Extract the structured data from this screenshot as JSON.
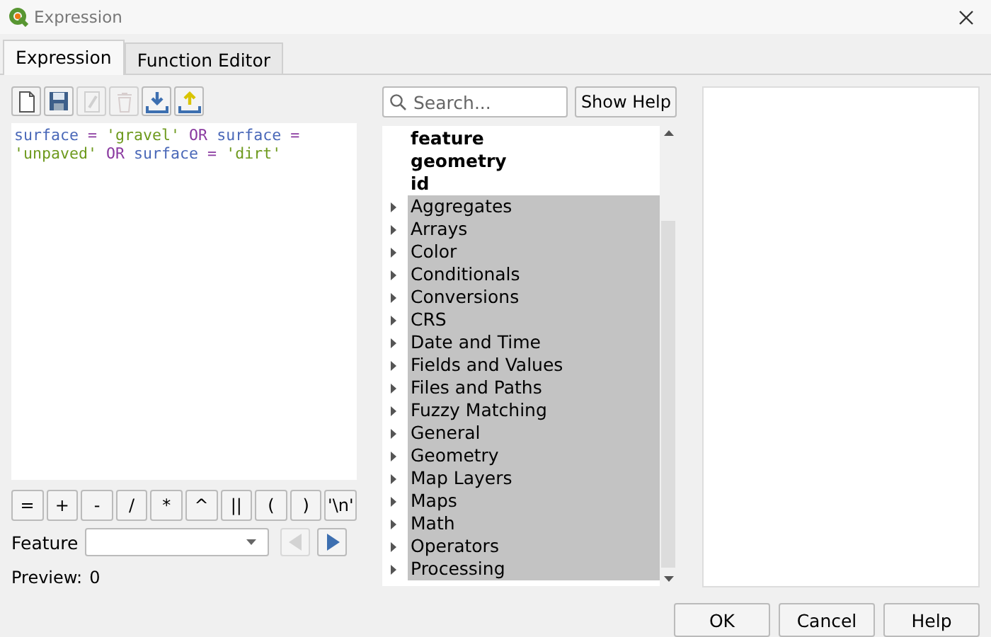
{
  "window": {
    "title": "Expression"
  },
  "tabs": [
    {
      "label": "Expression",
      "selected": true
    },
    {
      "label": "Function Editor",
      "selected": false
    }
  ],
  "toolbar": [
    {
      "kind": "new",
      "disabled": false
    },
    {
      "kind": "save",
      "disabled": false
    },
    {
      "kind": "edit",
      "disabled": true
    },
    {
      "kind": "delete",
      "disabled": true
    },
    {
      "kind": "import",
      "disabled": false
    },
    {
      "kind": "export",
      "disabled": false
    }
  ],
  "expression": [
    {
      "kind": "field",
      "text": "surface"
    },
    {
      "kind": "op",
      "text": " = "
    },
    {
      "kind": "string",
      "text": "'gravel'"
    },
    {
      "kind": "op",
      "text": " OR "
    },
    {
      "kind": "field",
      "text": "surface"
    },
    {
      "kind": "op",
      "text": " = "
    },
    {
      "kind": "string",
      "text": "'unpaved'"
    },
    {
      "kind": "op",
      "text": " OR "
    },
    {
      "kind": "field",
      "text": "surface"
    },
    {
      "kind": "op",
      "text": " = "
    },
    {
      "kind": "string",
      "text": "'dirt'"
    }
  ],
  "operators": [
    "=",
    "+",
    "-",
    "/",
    "*",
    "^",
    "||",
    "(",
    ")",
    "'\\n'"
  ],
  "feature": {
    "label": "Feature",
    "prev_disabled": true,
    "next_disabled": false
  },
  "preview": {
    "label": "Preview:",
    "value": "0"
  },
  "search": {
    "placeholder": "Search..."
  },
  "show_help": "Show Help",
  "tree": [
    {
      "kind": "field",
      "label": "feature"
    },
    {
      "kind": "field",
      "label": "geometry"
    },
    {
      "kind": "field",
      "label": "id"
    },
    {
      "kind": "group",
      "label": "Aggregates",
      "expanded": false
    },
    {
      "kind": "group",
      "label": "Arrays",
      "expanded": false
    },
    {
      "kind": "group",
      "label": "Color",
      "expanded": false
    },
    {
      "kind": "group",
      "label": "Conditionals",
      "expanded": false
    },
    {
      "kind": "group",
      "label": "Conversions",
      "expanded": false
    },
    {
      "kind": "group",
      "label": "CRS",
      "expanded": false
    },
    {
      "kind": "group",
      "label": "Date and Time",
      "expanded": false
    },
    {
      "kind": "group",
      "label": "Fields and Values",
      "expanded": false
    },
    {
      "kind": "group",
      "label": "Files and Paths",
      "expanded": false
    },
    {
      "kind": "group",
      "label": "Fuzzy Matching",
      "expanded": false
    },
    {
      "kind": "group",
      "label": "General",
      "expanded": false
    },
    {
      "kind": "group",
      "label": "Geometry",
      "expanded": false
    },
    {
      "kind": "group",
      "label": "Map Layers",
      "expanded": false
    },
    {
      "kind": "group",
      "label": "Maps",
      "expanded": false
    },
    {
      "kind": "group",
      "label": "Math",
      "expanded": false
    },
    {
      "kind": "group",
      "label": "Operators",
      "expanded": false
    },
    {
      "kind": "group",
      "label": "Processing",
      "expanded": false
    }
  ],
  "buttons": [
    "OK",
    "Cancel",
    "Help"
  ]
}
